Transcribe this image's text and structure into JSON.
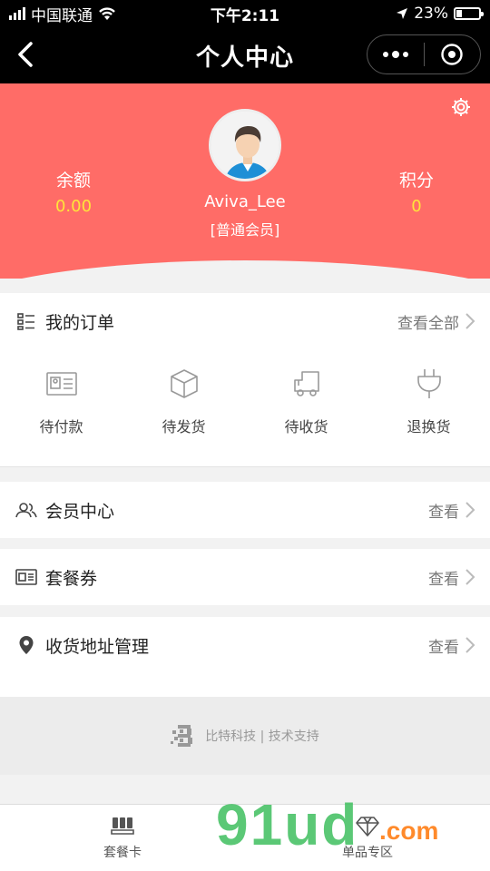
{
  "status_bar": {
    "carrier": "中国联通",
    "time": "下午2:11",
    "battery": "23%",
    "battery_level": 0.23
  },
  "nav": {
    "title": "个人中心"
  },
  "profile": {
    "username": "Aviva_Lee",
    "level": "[普通会员]",
    "balance_label": "余额",
    "balance_value": "0.00",
    "points_label": "积分",
    "points_value": "0"
  },
  "orders": {
    "title": "我的订单",
    "view_all": "查看全部",
    "items": [
      {
        "label": "待付款",
        "icon": "payment-card-icon"
      },
      {
        "label": "待发货",
        "icon": "box-icon"
      },
      {
        "label": "待收货",
        "icon": "truck-icon"
      },
      {
        "label": "退换货",
        "icon": "plug-icon"
      }
    ]
  },
  "menu": [
    {
      "label": "会员中心",
      "action": "查看",
      "icon": "members-icon"
    },
    {
      "label": "套餐券",
      "action": "查看",
      "icon": "coupon-card-icon"
    },
    {
      "label": "收货地址管理",
      "action": "查看",
      "icon": "location-pin-icon"
    }
  ],
  "footer": {
    "text": "比特科技 | 技术支持"
  },
  "tabbar": [
    {
      "label": "套餐卡",
      "icon": "card-pack-icon"
    },
    {
      "label": "单品专区",
      "icon": "diamond-icon"
    }
  ],
  "watermark": {
    "main": "91ud",
    "sub": ".com"
  }
}
